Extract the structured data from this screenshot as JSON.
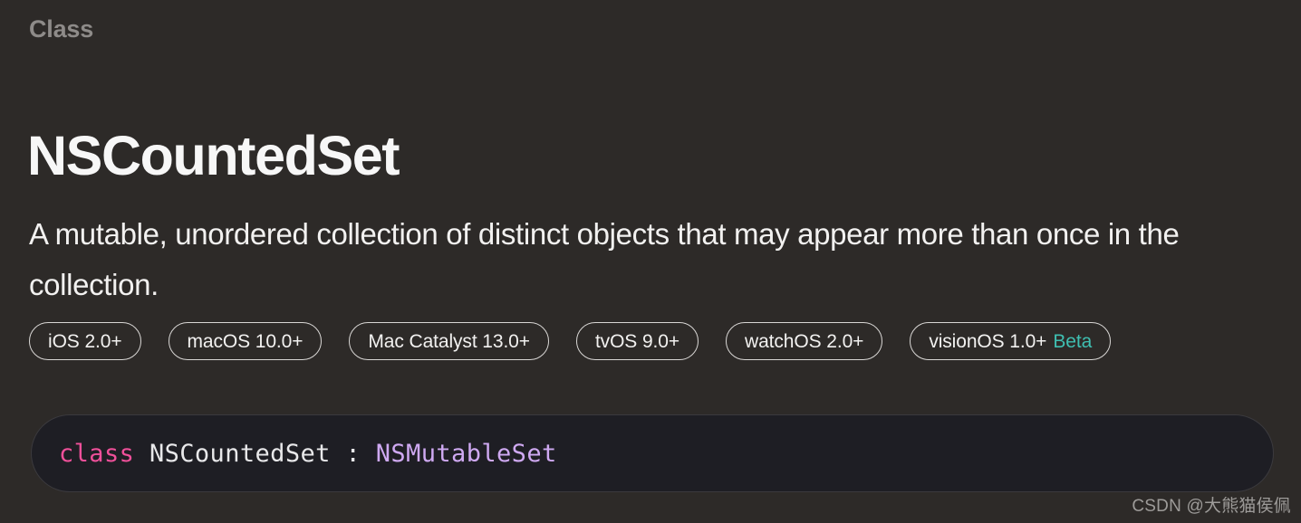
{
  "page": {
    "background_color": "#2d2a28",
    "eyebrow": "Class",
    "title": "NSCountedSet",
    "abstract": "A mutable, unordered collection of distinct objects that may appear more than once in the collection."
  },
  "availability": {
    "badges": [
      {
        "label": "iOS 2.0+",
        "beta": ""
      },
      {
        "label": "macOS 10.0+",
        "beta": ""
      },
      {
        "label": "Mac Catalyst 13.0+",
        "beta": ""
      },
      {
        "label": "tvOS 9.0+",
        "beta": ""
      },
      {
        "label": "watchOS 2.0+",
        "beta": ""
      },
      {
        "label": "visionOS 1.0+",
        "beta": "Beta"
      }
    ],
    "beta_color": "#3fbfb1",
    "badge_border_color": "#d8d6d4"
  },
  "declaration": {
    "background_color": "#1e1e24",
    "keyword": "class",
    "space_1": " ",
    "identifier": "NSCountedSet",
    "separator": " : ",
    "inherits": "NSMutableSet",
    "keyword_color": "#f0509a",
    "type_color": "#cfa9f2",
    "full_text": "class NSCountedSet : NSMutableSet"
  },
  "watermark": {
    "text": "CSDN @大熊猫侯佩",
    "color": "#9d9b99"
  }
}
